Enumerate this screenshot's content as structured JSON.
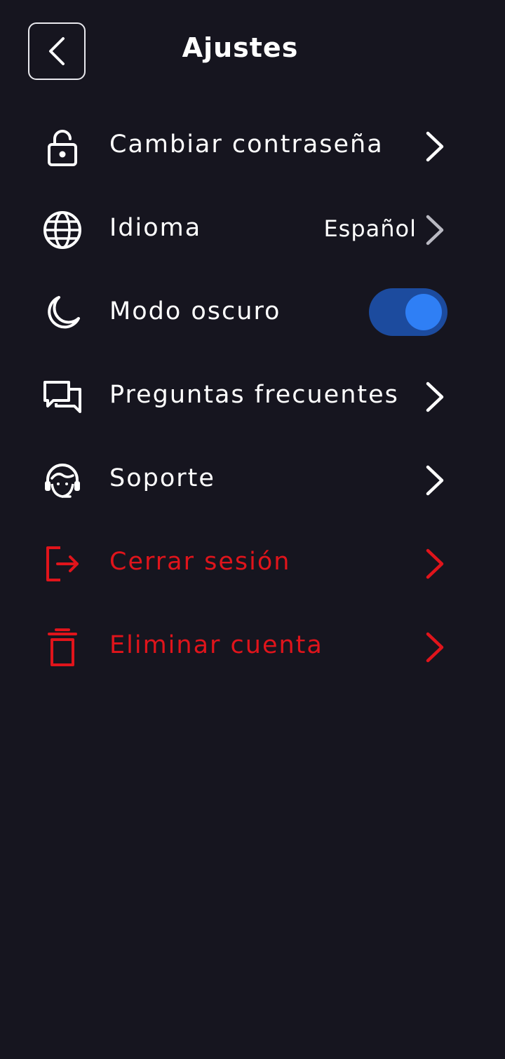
{
  "header": {
    "title": "Ajustes",
    "back_icon": "chevron-left-icon"
  },
  "settings": {
    "items": [
      {
        "label": "Cambiar contraseña",
        "icon": "lock-icon",
        "accessory": "chevron"
      },
      {
        "label": "Idioma",
        "icon": "globe-icon",
        "value": "Español",
        "accessory": "chevron"
      },
      {
        "label": "Modo oscuro",
        "icon": "moon-icon",
        "accessory": "toggle",
        "toggle_on": true
      },
      {
        "label": "Preguntas frecuentes",
        "icon": "chat-bubbles-icon",
        "accessory": "chevron"
      },
      {
        "label": "Soporte",
        "icon": "headset-icon",
        "accessory": "chevron"
      },
      {
        "label": "Cerrar sesión",
        "icon": "logout-icon",
        "accessory": "chevron",
        "danger": true
      },
      {
        "label": "Eliminar cuenta",
        "icon": "trash-icon",
        "accessory": "chevron",
        "danger": true
      }
    ]
  },
  "colors": {
    "background": "#16151f",
    "text": "#ffffff",
    "danger": "#e0141b",
    "toggle_track": "#1c4b9e",
    "toggle_knob": "#2f7ff5",
    "muted_chevron": "#b9b9c2"
  }
}
